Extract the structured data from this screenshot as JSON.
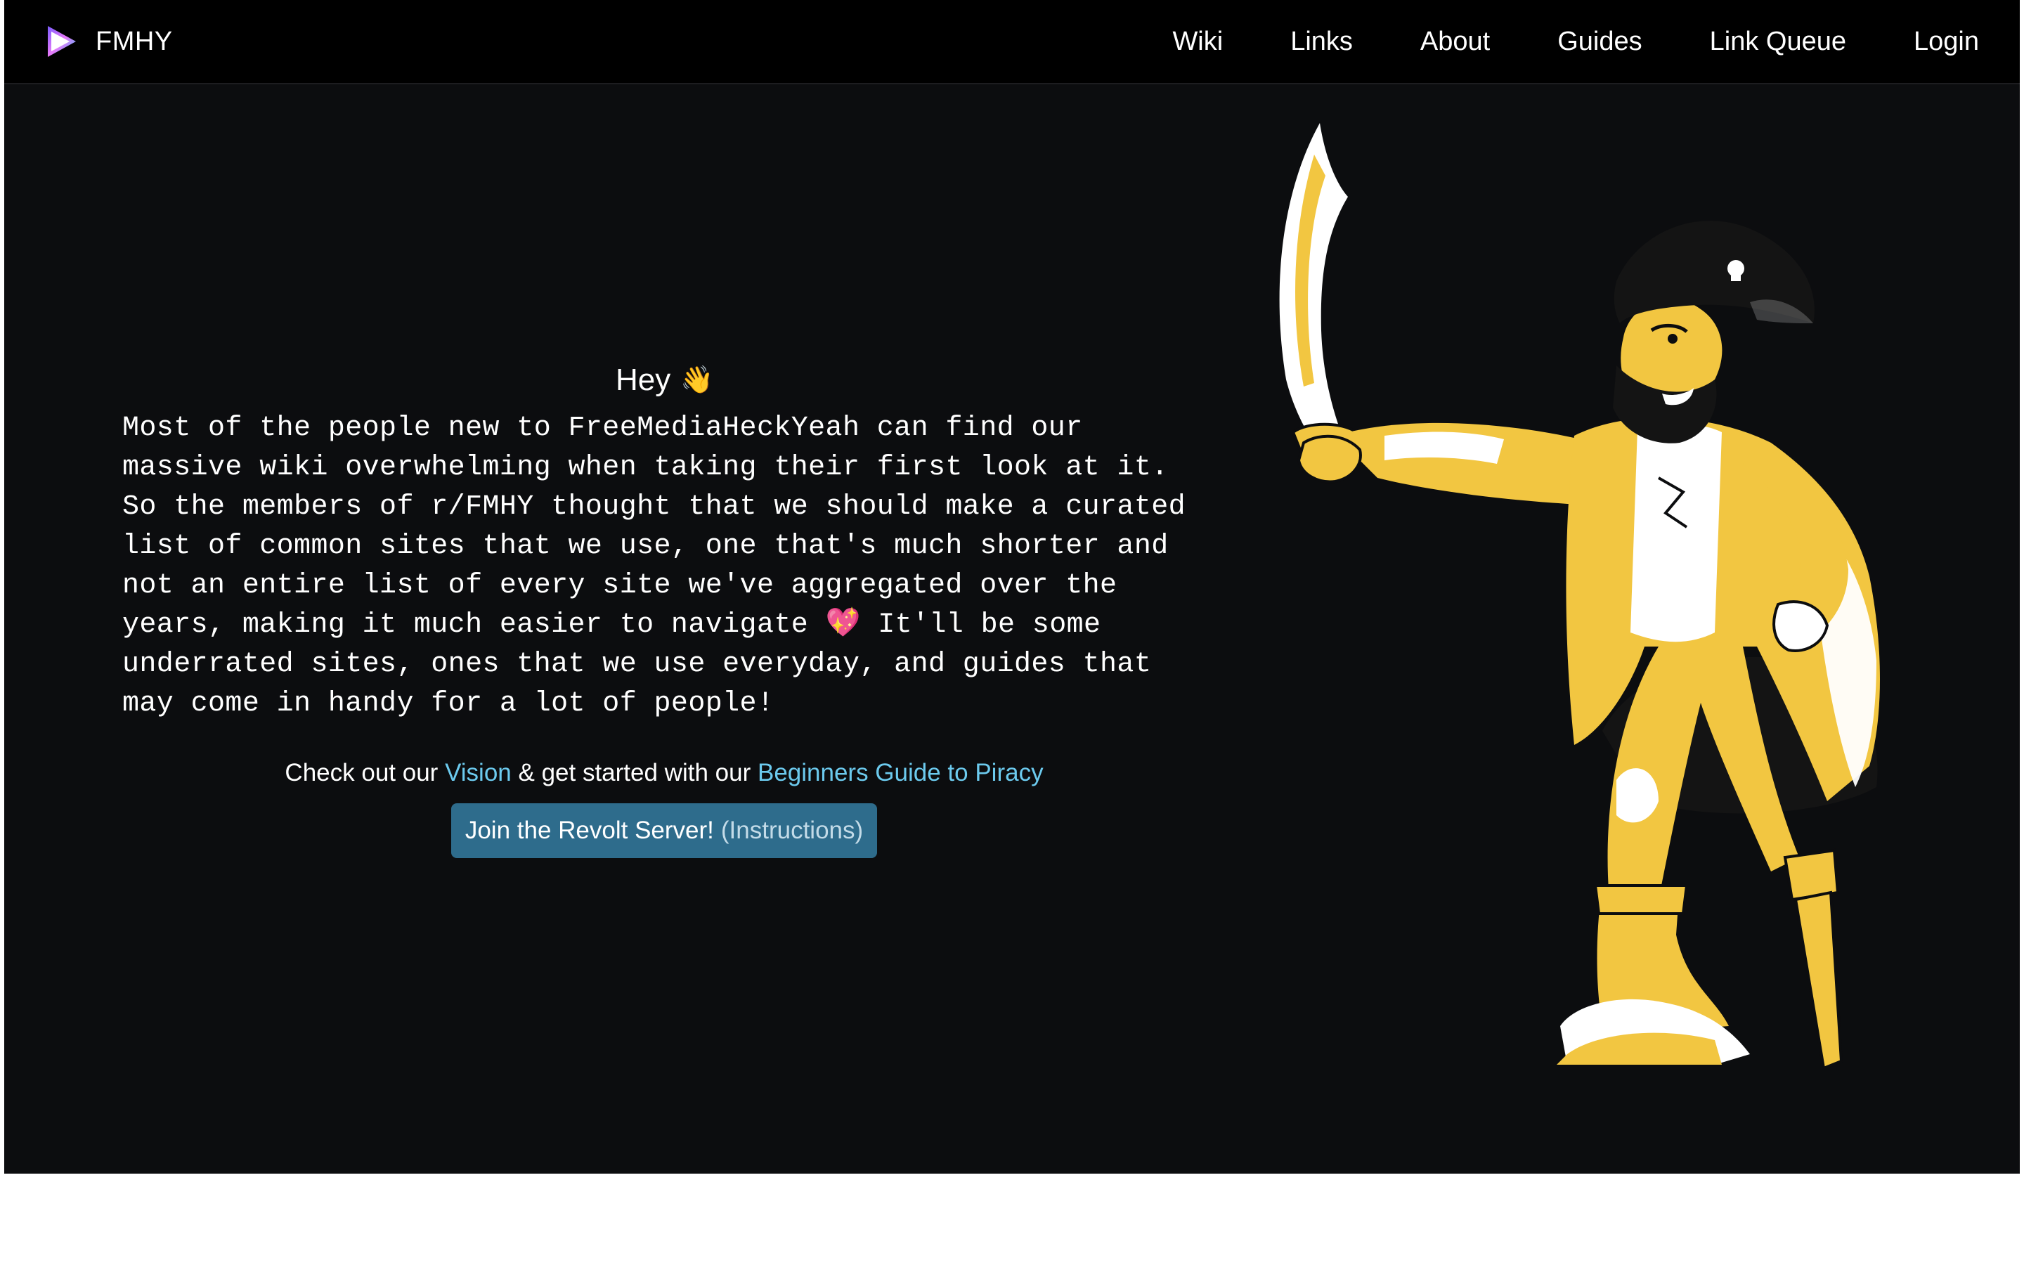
{
  "nav": {
    "brand": "FMHY",
    "links": [
      "Wiki",
      "Links",
      "About",
      "Guides",
      "Link Queue",
      "Login"
    ]
  },
  "hero": {
    "title": "Hey",
    "title_emoji": "👋",
    "intro_part1": "Most of the people new to FreeMediaHeckYeah can find our massive wiki overwhelming when taking their first look at it. So the members of r/FMHY thought that we should make a curated list of common sites that we use, one that's much shorter and not an entire list of every site we've aggregated over the years, making it much easier to navigate",
    "intro_emoji": "💖",
    "intro_part2": "It'll be some underrated sites, ones that we use everyday, and guides that may come in handy for a lot of people!"
  },
  "cta": {
    "prefix": "Check out our",
    "vision_link": "Vision",
    "middle": "& get started with our",
    "guide_link": "Beginners Guide to Piracy"
  },
  "revolt": {
    "label": "Join the Revolt Server!",
    "instructions": "(Instructions)"
  },
  "colors": {
    "background": "#0c0d0f",
    "navbar": "#000000",
    "link": "#6ccaee",
    "button": "#2e6c8c",
    "pirate_yellow": "#f2c641"
  },
  "icons": {
    "logo": "play-triangle-icon",
    "illustration": "pirate-illustration"
  }
}
